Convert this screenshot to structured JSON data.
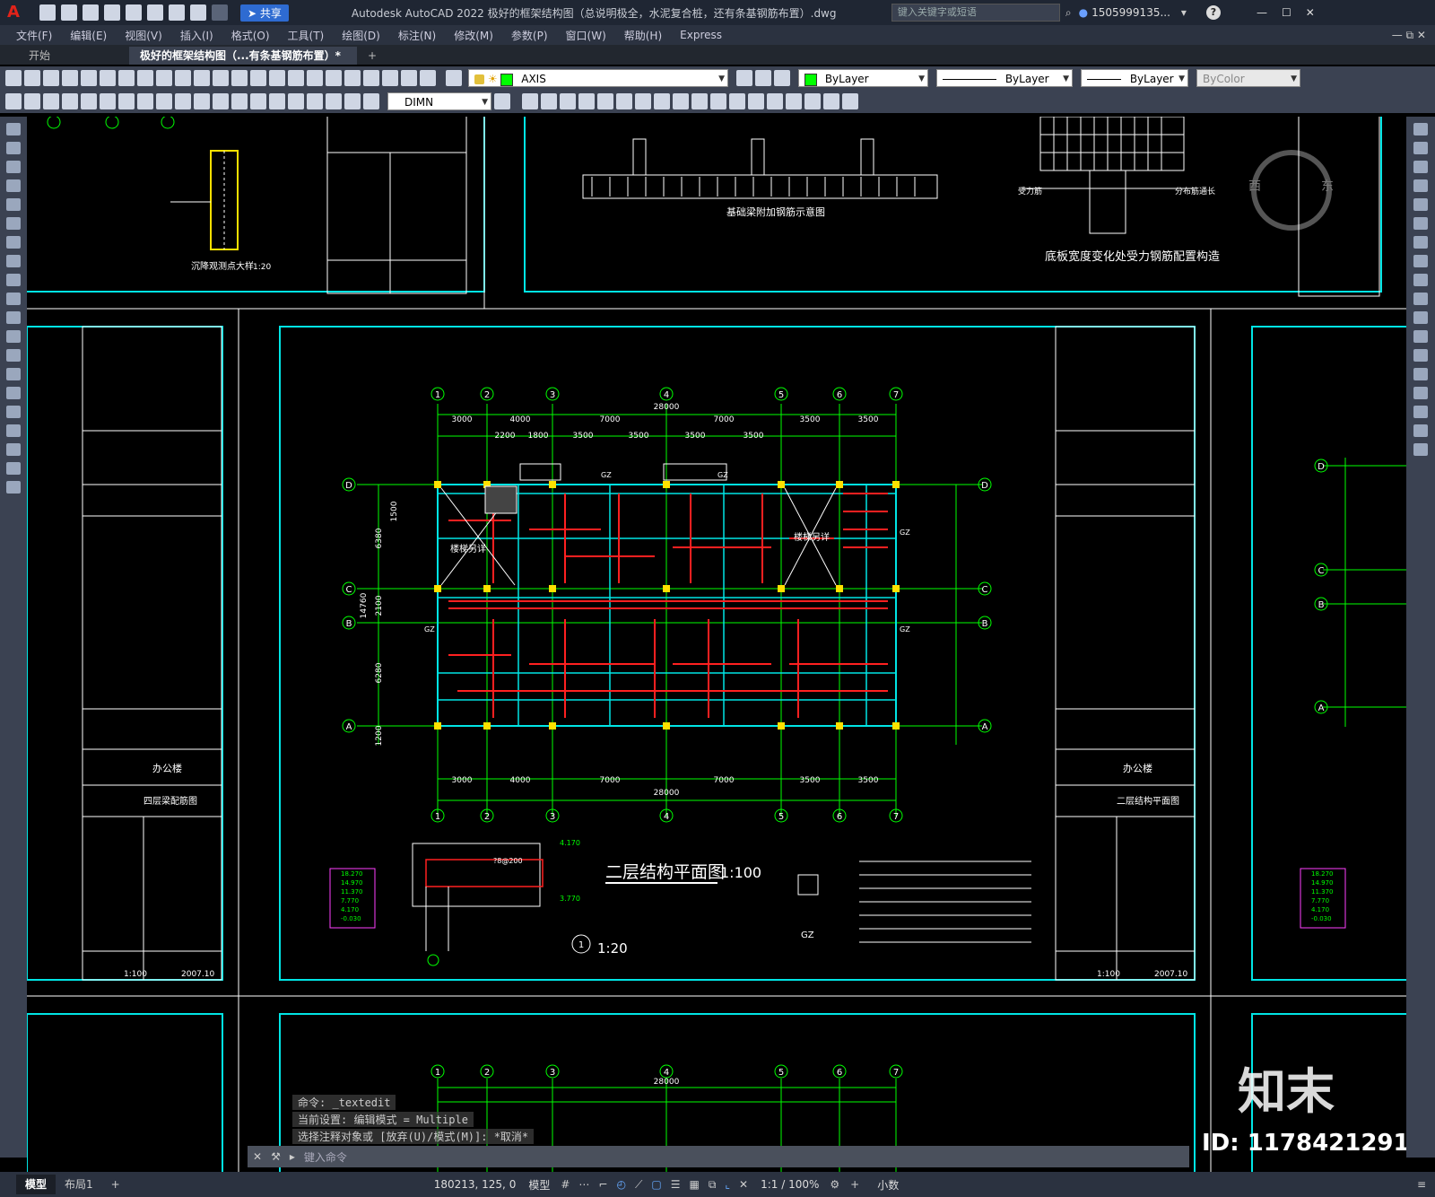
{
  "app": {
    "title": "Autodesk AutoCAD 2022   极好的框架结构图（总说明极全，水泥复合桩，还有条基钢筋布置）.dwg",
    "share_label": "共享",
    "search_placeholder": "键入关键字或短语",
    "user": "1505999135...",
    "help": "?"
  },
  "menu": [
    "文件(F)",
    "编辑(E)",
    "视图(V)",
    "插入(I)",
    "格式(O)",
    "工具(T)",
    "绘图(D)",
    "标注(N)",
    "修改(M)",
    "参数(P)",
    "窗口(W)",
    "帮助(H)",
    "Express"
  ],
  "tabs": {
    "start": "开始",
    "active": "极好的框架结构图（...有条基钢筋布置）*",
    "add": "+"
  },
  "toolbar": {
    "layer": "AXIS",
    "color": "ByLayer",
    "linetype": "ByLayer",
    "lineweight": "ByLayer",
    "plotstyle": "ByColor",
    "dimstyle": "DIMN"
  },
  "drawing": {
    "plan_title": "二层结构平面图",
    "plan_scale": "1:100",
    "detail_scale": "1:20",
    "detail_number": "1",
    "gz_label": "GZ",
    "axis_numbers": [
      "1",
      "2",
      "3",
      "4",
      "5",
      "6",
      "7"
    ],
    "axis_letters": [
      "D",
      "C",
      "B",
      "A"
    ],
    "top_dims": [
      "3000",
      "4000",
      "7000",
      "7000",
      "3500",
      "3500"
    ],
    "total_dim": "28000",
    "inner_dims": [
      "2200",
      "1800",
      "3500",
      "3500",
      "3500",
      "3500"
    ],
    "left_dims": [
      "1500",
      "6380",
      "14760",
      "2100",
      "6280",
      "1200"
    ],
    "top_left_note": "沉降观测点大样",
    "top_left_scale": "1:20",
    "top_center_note": "基础梁附加钢筋示意图",
    "top_right_note": "底板宽度变化处受力钢筋配置构造",
    "top_right_labels": [
      "受力筋",
      "分布筋通长"
    ],
    "titleblock_project": "办公楼",
    "titleblock_left_drawing": "四层梁配筋图",
    "titleblock_right_drawing": "二层结构平面图",
    "titleblock_scale": "1:100",
    "titleblock_date": "2007.10",
    "stair_label": "楼梯另详",
    "elevations": [
      "18.270",
      "14.970",
      "11.370",
      "7.770",
      "4.170",
      "-0.030"
    ],
    "elevation_right": [
      "18.270",
      "14.970",
      "11.370",
      "7.770",
      "4.170",
      "-0.030"
    ],
    "level_a": "4.170",
    "level_b": "3.770",
    "beam_rebar": "?8@200",
    "compass_w": "西",
    "compass_e": "东",
    "watermark_brand": "知末",
    "watermark_id": "ID: 1178421291"
  },
  "command": {
    "line1": "命令: _textedit",
    "line2": "当前设置: 编辑模式 = Multiple",
    "line3": "选择注释对象或 [放弃(U)/模式(M)]: *取消*",
    "prompt": "键入命令"
  },
  "status": {
    "model_tab": "模型",
    "layout_tab": "布局1",
    "add_tab": "+",
    "coords": "180213, 125, 0",
    "mode": "模型",
    "scale": "1:1 / 100%",
    "units": "小数"
  },
  "colors": {
    "frame_cyan": "#00e5e5",
    "grid_green": "#00ff00",
    "rebar_red": "#ff2020",
    "column_yellow": "#ffe000",
    "line_white": "#ffffff"
  }
}
